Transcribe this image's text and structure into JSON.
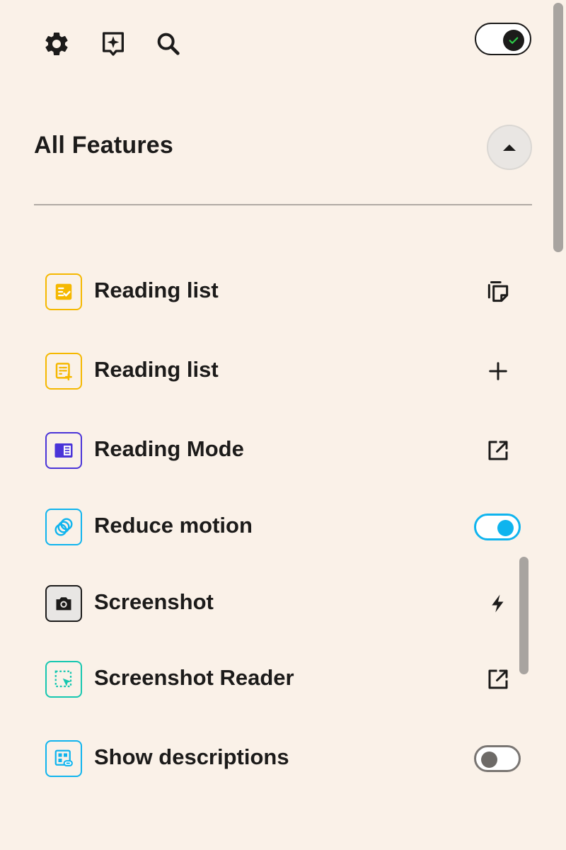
{
  "toolbar": {
    "settings_icon": "gear-icon",
    "ai_icon": "sparkle-bubble-icon",
    "search_icon": "search-icon",
    "master_toggle_state": "on"
  },
  "section": {
    "title": "All Features",
    "collapse_icon": "caret-up-icon"
  },
  "features": [
    {
      "label": "Reading list",
      "icon": "checklist-icon",
      "color": "#F5B800",
      "action": "copy-icon"
    },
    {
      "label": "Reading list",
      "icon": "list-add-icon",
      "color": "#F5B800",
      "action": "plus-icon"
    },
    {
      "label": "Reading Mode",
      "icon": "reader-view-icon",
      "color": "#4A34D8",
      "action": "external-link-icon"
    },
    {
      "label": "Reduce motion",
      "icon": "motion-circles-icon",
      "color": "#0FB4EE",
      "action": "toggle",
      "toggle": "on"
    },
    {
      "label": "Screenshot",
      "icon": "camera-icon",
      "color": "#1c1b1a",
      "action": "bolt-icon"
    },
    {
      "label": "Screenshot Reader",
      "icon": "selection-cursor-icon",
      "color": "#16C7B0",
      "action": "external-link-icon"
    },
    {
      "label": "Show descriptions",
      "icon": "description-grid-icon",
      "color": "#0FB4EE",
      "action": "toggle",
      "toggle": "off"
    }
  ],
  "colors": {
    "background": "#FAF1E8",
    "accent": "#0FB4EE",
    "text": "#1c1b1a"
  }
}
